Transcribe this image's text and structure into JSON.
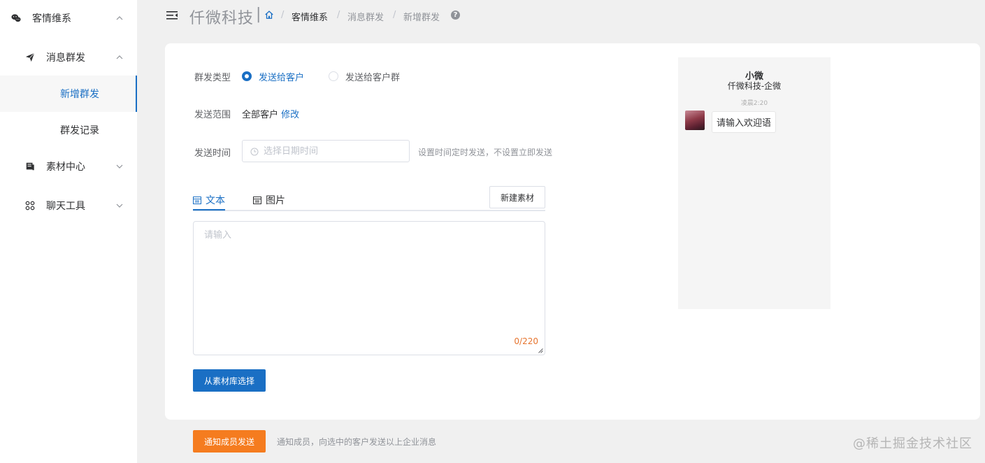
{
  "sidebar": {
    "items": [
      {
        "label": "客情维系",
        "icon": "wechat-icon",
        "expanded": true
      },
      {
        "label": "消息群发",
        "icon": "paper-plane-icon",
        "expanded": true
      },
      {
        "label": "新增群发",
        "active": true
      },
      {
        "label": "群发记录"
      },
      {
        "label": "素材中心",
        "icon": "archive-icon",
        "expanded": false
      },
      {
        "label": "聊天工具",
        "icon": "grid-icon",
        "expanded": false
      }
    ]
  },
  "header": {
    "brand": "仟微科技",
    "separator": "|",
    "breadcrumb": [
      "客情维系",
      "消息群发",
      "新增群发"
    ],
    "crumb_separator": "/"
  },
  "form": {
    "type_label": "群发类型",
    "type_options": [
      {
        "label": "发送给客户",
        "checked": true
      },
      {
        "label": "发送给客户群",
        "checked": false
      }
    ],
    "range_label": "发送范围",
    "range_value": "全部客户",
    "range_edit": "修改",
    "time_label": "发送时间",
    "time_placeholder": "选择日期时间",
    "time_hint": "设置时间定时发送，不设置立即发送",
    "tabs": [
      {
        "label": "文本",
        "icon": "calendar-icon",
        "active": true
      },
      {
        "label": "图片",
        "icon": "calendar-icon",
        "active": false
      }
    ],
    "new_material_button": "新建素材",
    "textarea_placeholder": "请输入",
    "counter": "0/220",
    "library_button": "从素材库选择"
  },
  "preview": {
    "name": "小微",
    "corp": "仟微科技-企微",
    "time": "凌晨2:20",
    "bubble": "请输入欢迎语"
  },
  "footer": {
    "notify_button": "通知成员发送",
    "notify_hint": "通知成员，向选中的客户发送以上企业消息",
    "watermark": "@稀土掘金技术社区"
  },
  "colors": {
    "primary": "#1a6fc4",
    "orange": "#f57c1f",
    "counter": "#e6742e"
  }
}
